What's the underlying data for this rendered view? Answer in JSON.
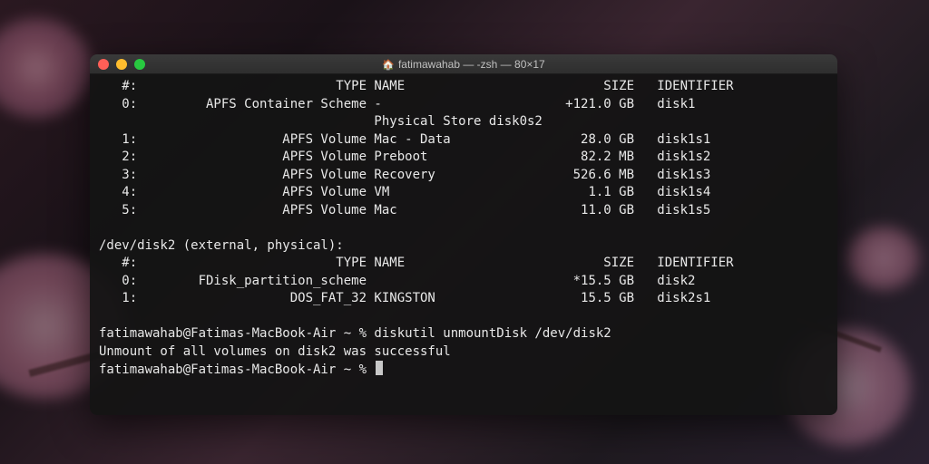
{
  "window": {
    "title_prefix_icon": "🏠",
    "title": "fatimawahab — -zsh — 80×17"
  },
  "disk1": {
    "header": {
      "num": "#:",
      "type": "TYPE",
      "name": "NAME",
      "size": "SIZE",
      "identifier": "IDENTIFIER"
    },
    "rows": [
      {
        "num": "0:",
        "type": "APFS Container Scheme",
        "name": "-",
        "size": "+121.0 GB",
        "identifier": "disk1"
      }
    ],
    "physical_store": "Physical Store disk0s2",
    "volumes": [
      {
        "num": "1:",
        "type": "APFS Volume",
        "name": "Mac - Data",
        "size": "28.0 GB",
        "identifier": "disk1s1"
      },
      {
        "num": "2:",
        "type": "APFS Volume",
        "name": "Preboot",
        "size": "82.2 MB",
        "identifier": "disk1s2"
      },
      {
        "num": "3:",
        "type": "APFS Volume",
        "name": "Recovery",
        "size": "526.6 MB",
        "identifier": "disk1s3"
      },
      {
        "num": "4:",
        "type": "APFS Volume",
        "name": "VM",
        "size": "1.1 GB",
        "identifier": "disk1s4"
      },
      {
        "num": "5:",
        "type": "APFS Volume",
        "name": "Mac",
        "size": "11.0 GB",
        "identifier": "disk1s5"
      }
    ]
  },
  "disk2": {
    "device_header": "/dev/disk2 (external, physical):",
    "header": {
      "num": "#:",
      "type": "TYPE",
      "name": "NAME",
      "size": "SIZE",
      "identifier": "IDENTIFIER"
    },
    "rows": [
      {
        "num": "0:",
        "type": "FDisk_partition_scheme",
        "name": "",
        "size": "*15.5 GB",
        "identifier": "disk2"
      },
      {
        "num": "1:",
        "type": "DOS_FAT_32",
        "name": "KINGSTON",
        "size": "15.5 GB",
        "identifier": "disk2s1"
      }
    ]
  },
  "prompt": {
    "line1_prompt": "fatimawahab@Fatimas-MacBook-Air ~ % ",
    "line1_command": "diskutil unmountDisk /dev/disk2",
    "line2_output": "Unmount of all volumes on disk2 was successful",
    "line3_prompt": "fatimawahab@Fatimas-MacBook-Air ~ % "
  }
}
